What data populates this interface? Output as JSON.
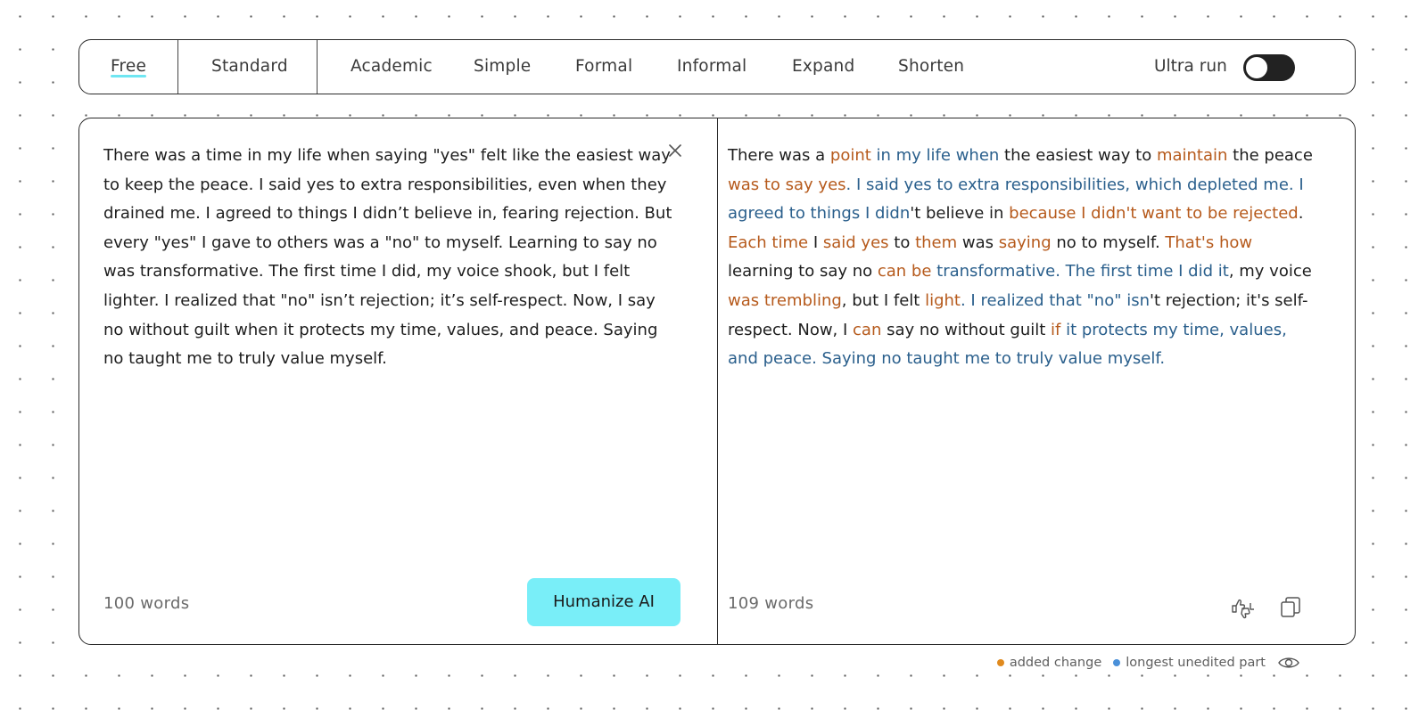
{
  "toolbar": {
    "modes": [
      "Free",
      "Standard",
      "Academic",
      "Simple",
      "Formal",
      "Informal",
      "Expand",
      "Shorten"
    ],
    "active_mode": "Free",
    "ultra_run_label": "Ultra run",
    "ultra_run_enabled": true
  },
  "input": {
    "text": "There was a time in my life when saying \"yes\" felt like the easiest way to keep the peace. I said yes to extra responsibilities, even when they drained me. I agreed to things I didn’t believe in, fearing rejection. But every \"yes\" I gave to others was a \"no\" to myself. Learning to say no was transformative. The first time I did, my voice shook, but I felt lighter. I realized that \"no\" isn’t rejection; it’s self-respect. Now, I say no without guilt when it protects my time, values, and peace. Saying no taught me to truly value myself.",
    "word_count": "100 words",
    "humanize_label": "Humanize AI"
  },
  "output": {
    "segments": [
      {
        "text": "There was a ",
        "type": "plain"
      },
      {
        "text": "point",
        "type": "added"
      },
      {
        "text": " in my life when",
        "type": "unedited"
      },
      {
        "text": " the easiest way to ",
        "type": "plain"
      },
      {
        "text": "maintain",
        "type": "added"
      },
      {
        "text": " the peace ",
        "type": "plain"
      },
      {
        "text": "was to say yes",
        "type": "added"
      },
      {
        "text": ". I said yes to extra responsibilities, which depleted me. I agreed to things I didn",
        "type": "unedited"
      },
      {
        "text": "'t believe in ",
        "type": "plain"
      },
      {
        "text": "because I didn't want to be rejected",
        "type": "added"
      },
      {
        "text": ". ",
        "type": "plain"
      },
      {
        "text": "Each time",
        "type": "added"
      },
      {
        "text": " I ",
        "type": "plain"
      },
      {
        "text": "said yes",
        "type": "added"
      },
      {
        "text": " to ",
        "type": "plain"
      },
      {
        "text": "them",
        "type": "added"
      },
      {
        "text": " was ",
        "type": "plain"
      },
      {
        "text": "saying",
        "type": "added"
      },
      {
        "text": " no to myself. ",
        "type": "plain"
      },
      {
        "text": "That's how",
        "type": "added"
      },
      {
        "text": " learning to say no ",
        "type": "plain"
      },
      {
        "text": "can be",
        "type": "added"
      },
      {
        "text": " transformative. The first time I did it",
        "type": "unedited"
      },
      {
        "text": ", my voice ",
        "type": "plain"
      },
      {
        "text": "was trembling",
        "type": "added"
      },
      {
        "text": ", but I felt ",
        "type": "plain"
      },
      {
        "text": "light",
        "type": "added"
      },
      {
        "text": ". I realized that \"no\" isn",
        "type": "unedited"
      },
      {
        "text": "'t rejection; it's self-respect. Now, I ",
        "type": "plain"
      },
      {
        "text": "can",
        "type": "added"
      },
      {
        "text": " say no without guilt ",
        "type": "plain"
      },
      {
        "text": "if",
        "type": "added"
      },
      {
        "text": " it protects my time, values, and peace. Saying no taught me to truly value myself.",
        "type": "unedited"
      }
    ],
    "word_count": "109 words"
  },
  "legend": {
    "added_label": "added change",
    "unedited_label": "longest unedited part"
  },
  "colors": {
    "added": "#b65a1c",
    "unedited": "#2a5f8c",
    "added_dot": "#e08a1e",
    "unedited_dot": "#4a90d9",
    "accent": "#79eef8",
    "underline": "#6fe6f2"
  },
  "icons": [
    "close-icon",
    "thumbs-feedback-icon",
    "copy-icon",
    "eye-icon"
  ]
}
